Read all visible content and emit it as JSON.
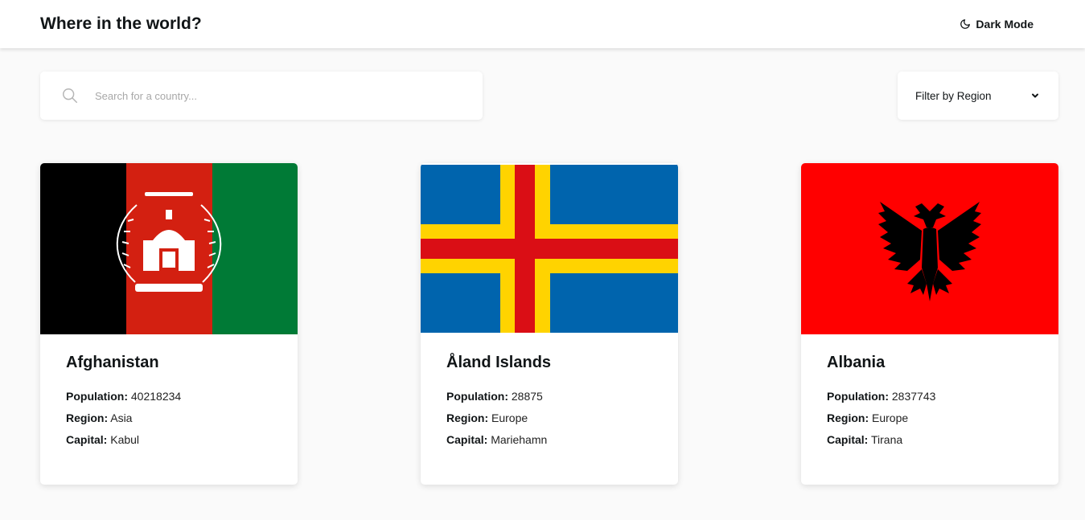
{
  "header": {
    "title": "Where in the world?",
    "mode_toggle": {
      "icon": "moon-icon",
      "label": "Dark Mode"
    }
  },
  "search": {
    "icon": "search-icon",
    "placeholder": "Search for a country...",
    "value": ""
  },
  "filter": {
    "label": "Filter by Region",
    "icon": "chevron-down-icon"
  },
  "labels": {
    "population": "Population:",
    "region": "Region:",
    "capital": "Capital:"
  },
  "countries": [
    {
      "name": "Afghanistan",
      "population": "40218234",
      "region": "Asia",
      "capital": "Kabul",
      "flag": {
        "description": "afghanistan-flag",
        "colors": [
          "#000000",
          "#d32011",
          "#007a36",
          "#ffffff"
        ]
      }
    },
    {
      "name": "Åland Islands",
      "population": "28875",
      "region": "Europe",
      "capital": "Mariehamn",
      "flag": {
        "description": "aland-flag",
        "colors": [
          "#0064ad",
          "#ffd300",
          "#da0e15"
        ]
      }
    },
    {
      "name": "Albania",
      "population": "2837743",
      "region": "Europe",
      "capital": "Tirana",
      "flag": {
        "description": "albania-flag",
        "colors": [
          "#ff0000",
          "#000000"
        ]
      }
    }
  ],
  "colors": {
    "background": "#fafafa",
    "surface": "#ffffff",
    "text": "#111517"
  }
}
